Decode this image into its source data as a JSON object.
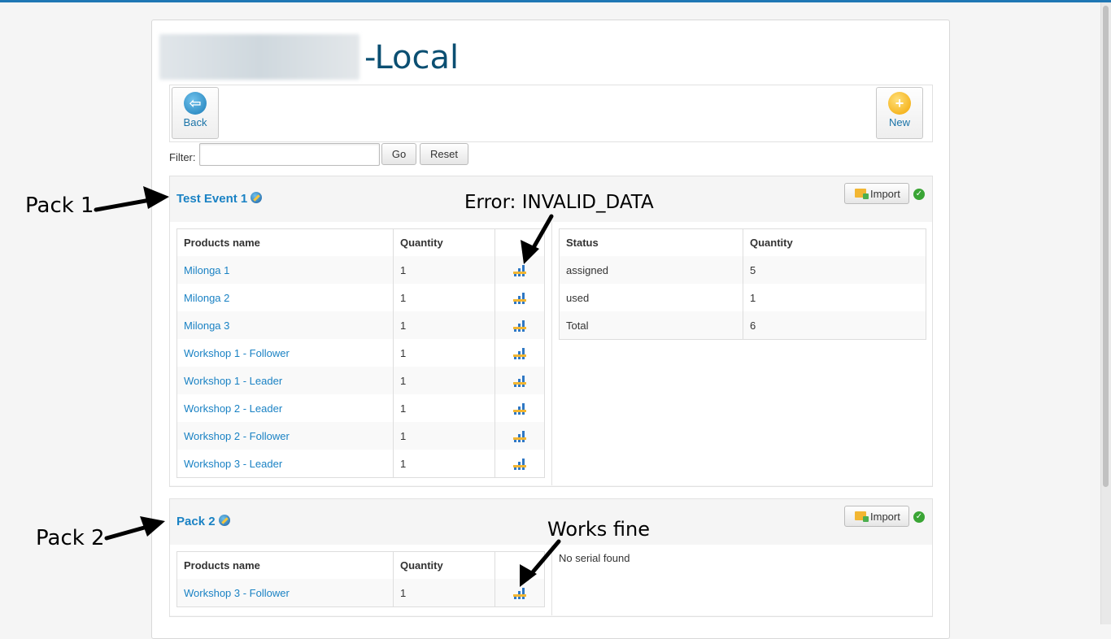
{
  "header": {
    "title": "Local",
    "title_prefix": "-"
  },
  "toolbar": {
    "back_label": "Back",
    "new_label": "New"
  },
  "filter": {
    "label": "Filter:",
    "value": "",
    "go_label": "Go",
    "reset_label": "Reset"
  },
  "packs": [
    {
      "title": "Test Event 1",
      "import_label": "Import",
      "products": {
        "headers": [
          "Products name",
          "Quantity"
        ],
        "rows": [
          {
            "name": "Milonga 1",
            "qty": "1"
          },
          {
            "name": "Milonga 2",
            "qty": "1"
          },
          {
            "name": "Milonga 3",
            "qty": "1"
          },
          {
            "name": "Workshop 1 - Follower",
            "qty": "1"
          },
          {
            "name": "Workshop 1 - Leader",
            "qty": "1"
          },
          {
            "name": "Workshop 2 - Leader",
            "qty": "1"
          },
          {
            "name": "Workshop 2 - Follower",
            "qty": "1"
          },
          {
            "name": "Workshop 3 - Leader",
            "qty": "1"
          }
        ]
      },
      "status": {
        "headers": [
          "Status",
          "Quantity"
        ],
        "rows": [
          {
            "status": "assigned",
            "qty": "5"
          },
          {
            "status": "used",
            "qty": "1"
          },
          {
            "status": "Total",
            "qty": "6"
          }
        ]
      }
    },
    {
      "title": "Pack 2",
      "import_label": "Import",
      "products": {
        "headers": [
          "Products name",
          "Quantity"
        ],
        "rows": [
          {
            "name": "Workshop 3 - Follower",
            "qty": "1"
          }
        ]
      },
      "no_serial_text": "No serial found"
    }
  ],
  "annotations": {
    "pack1": "Pack 1",
    "pack2": "Pack 2",
    "error": "Error: INVALID_DATA",
    "works": "Works fine"
  },
  "colors": {
    "accent": "#1a82c4",
    "title": "#0b4f72",
    "ok": "#3aa535",
    "topbar": "#1f77b4"
  }
}
